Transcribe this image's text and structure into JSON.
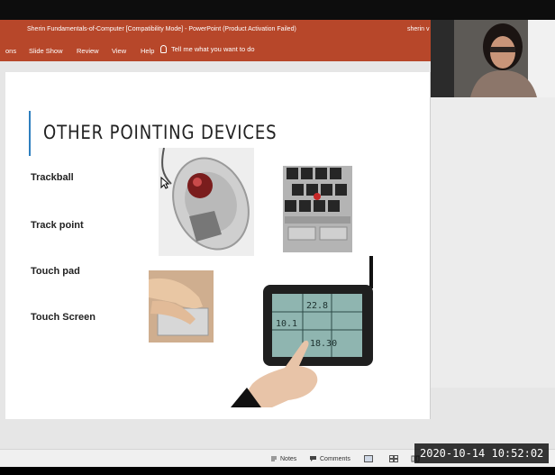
{
  "window": {
    "title": "Sherin Fundamentals-of-Computer [Compatibility Mode]  -  PowerPoint (Product Activation Failed)",
    "user": "sherin v"
  },
  "ribbon": {
    "tabs": [
      "ons",
      "Slide Show",
      "Review",
      "View",
      "Help"
    ],
    "tell_me": "Tell me what you want to do"
  },
  "slide": {
    "title": "OTHER POINTING DEVICES",
    "items": [
      "Trackball",
      "Track point",
      "Touch pad",
      "Touch Screen"
    ],
    "screen_texts": [
      "10.1",
      "22.8",
      "18.30"
    ]
  },
  "statusbar": {
    "notes_label": "Notes",
    "comments_label": "Comments"
  },
  "overlay": {
    "timestamp": "2020-10-14  10:52:02"
  },
  "colors": {
    "ribbon": "#b7472a",
    "title_accent": "#2e7fbf",
    "workspace": "#e6e6e6"
  },
  "icons": [
    "lightbulb-icon",
    "notes-icon",
    "comments-icon",
    "normal-view-icon",
    "slide-sorter-icon",
    "reading-view-icon",
    "cursor-icon"
  ]
}
